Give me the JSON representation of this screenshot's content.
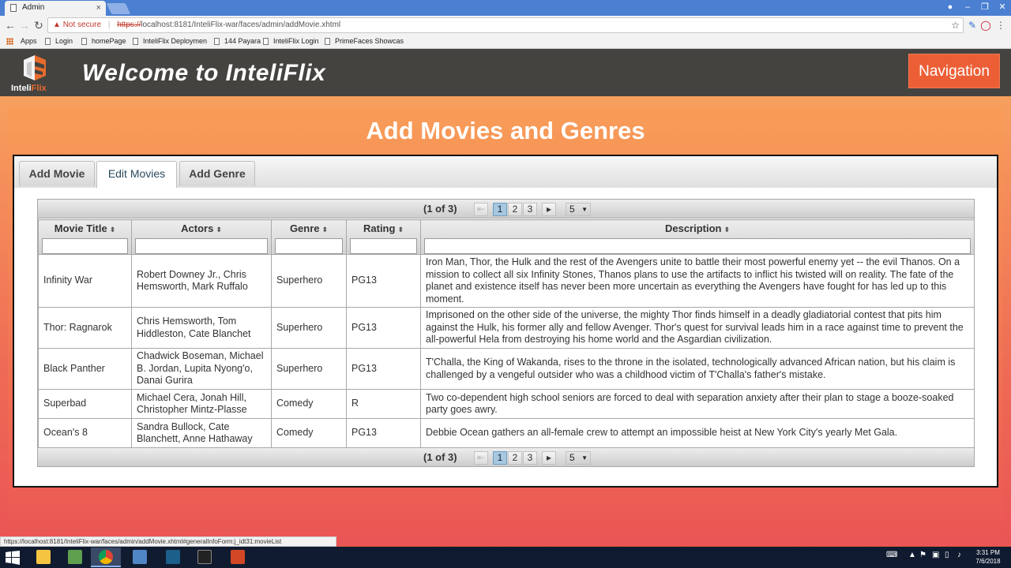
{
  "browser": {
    "tab_title": "Admin",
    "tab_close": "×",
    "url_warning": "Not secure",
    "url_scheme": "https://",
    "url_rest": "localhost:8181/InteliFlix-war/faces/admin/addMovie.xhtml",
    "bookmarks": [
      "Apps",
      "Login",
      "homePage",
      "InteliFlix Deploymen",
      "144 Payara",
      "InteliFlix Login",
      "PrimeFaces Showcas"
    ],
    "status_url": "https://localhost:8181/InteliFlix-war/faces/admin/addMovie.xhtml#generalInfoForm:j_idt31:movieList"
  },
  "app": {
    "logo_text_a": "Inteli",
    "logo_text_b": "Flix",
    "welcome": "Welcome to InteliFlix",
    "nav_button": "Navigation"
  },
  "page": {
    "title": "Add Movies and Genres",
    "tabs": [
      {
        "label": "Add Movie"
      },
      {
        "label": "Edit Movies"
      },
      {
        "label": "Add Genre"
      }
    ]
  },
  "table": {
    "paginator": {
      "report": "(1 of 3)",
      "pages": [
        "1",
        "2",
        "3"
      ],
      "first": "⇤",
      "next": "▸",
      "rows_per_page": "5"
    },
    "columns": [
      "Movie Title",
      "Actors",
      "Genre",
      "Rating",
      "Description"
    ],
    "rows": [
      {
        "title": "Infinity War",
        "actors": "Robert Downey Jr., Chris Hemsworth, Mark Ruffalo",
        "genre": "Superhero",
        "rating": "PG13",
        "description": "Iron Man, Thor, the Hulk and the rest of the Avengers unite to battle their most powerful enemy yet -- the evil Thanos. On a mission to collect all six Infinity Stones, Thanos plans to use the artifacts to inflict his twisted will on reality. The fate of the planet and existence itself has never been more uncertain as everything the Avengers have fought for has led up to this moment."
      },
      {
        "title": "Thor: Ragnarok",
        "actors": "Chris Hemsworth, Tom Hiddleston, Cate Blanchet",
        "genre": "Superhero",
        "rating": "PG13",
        "description": "Imprisoned on the other side of the universe, the mighty Thor finds himself in a deadly gladiatorial contest that pits him against the Hulk, his former ally and fellow Avenger. Thor's quest for survival leads him in a race against time to prevent the all-powerful Hela from destroying his home world and the Asgardian civilization."
      },
      {
        "title": "Black Panther",
        "actors": "Chadwick Boseman, Michael B. Jordan, Lupita Nyong'o, Danai Gurira",
        "genre": "Superhero",
        "rating": "PG13",
        "description": "T'Challa, the King of Wakanda, rises to the throne in the isolated, technologically advanced African nation, but his claim is challenged by a vengeful outsider who was a childhood victim of T'Challa's father's mistake."
      },
      {
        "title": "Superbad",
        "actors": "Michael Cera, Jonah Hill, Christopher Mintz-Plasse",
        "genre": "Comedy",
        "rating": "R",
        "description": "Two co-dependent high school seniors are forced to deal with separation anxiety after their plan to stage a booze-soaked party goes awry."
      },
      {
        "title": "Ocean's 8",
        "actors": "Sandra Bullock, Cate Blanchett, Anne Hathaway",
        "genre": "Comedy",
        "rating": "PG13",
        "description": "Debbie Ocean gathers an all-female crew to attempt an impossible heist at New York City's yearly Met Gala."
      }
    ]
  },
  "taskbar": {
    "time": "3:31 PM",
    "date": "7/6/2018"
  },
  "colors": {
    "header_bg": "#454340",
    "accent": "#ec5f36",
    "page_gradient_top": "#f7a05e",
    "page_gradient_bottom": "#ea5555"
  }
}
